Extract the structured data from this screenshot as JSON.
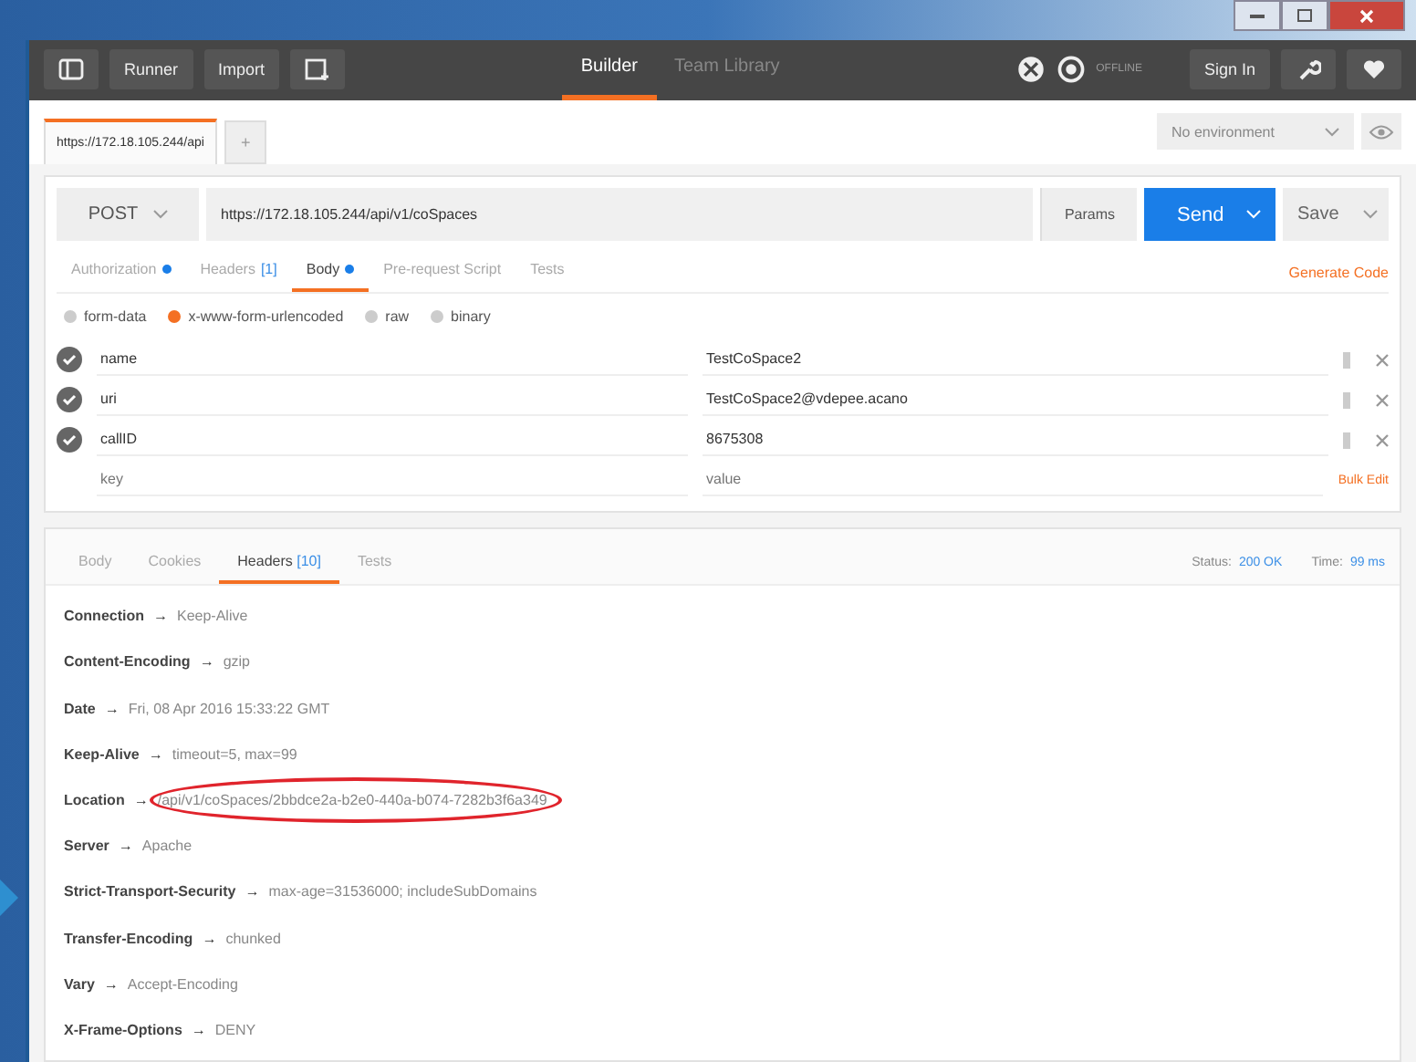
{
  "toolbar": {
    "buttons": [
      "Runner",
      "Import"
    ],
    "tabs": [
      {
        "label": "Builder",
        "selected": true
      },
      {
        "label": "Team Library",
        "selected": false
      }
    ],
    "status": "OFFLINE",
    "sign_in": "Sign In"
  },
  "request_tabs": [
    {
      "label": "https://172.18.105.244/api",
      "selected": true
    }
  ],
  "new_tab": "+",
  "environment": {
    "value": "No environment"
  },
  "request": {
    "method": "POST",
    "url": "https://172.18.105.244/api/v1/coSpaces",
    "params": "Params",
    "send": "Send",
    "save": "Save"
  },
  "request_sections": [
    {
      "label": "Authorization",
      "has_content": true,
      "selected": false
    },
    {
      "label": "Headers",
      "count": "[1]",
      "has_content": false,
      "selected": false
    },
    {
      "label": "Body",
      "has_content": true,
      "selected": true
    },
    {
      "label": "Pre-request Script",
      "has_content": false,
      "selected": false
    },
    {
      "label": "Tests",
      "has_content": false,
      "selected": false
    }
  ],
  "generate_code": "Generate Code",
  "body_modes": [
    {
      "label": "form-data",
      "selected": false
    },
    {
      "label": "x-www-form-urlencoded",
      "selected": true
    },
    {
      "label": "raw",
      "selected": false
    },
    {
      "label": "binary",
      "selected": false
    }
  ],
  "params": [
    {
      "key": "name",
      "value": "TestCoSpace2",
      "checked": true
    },
    {
      "key": "uri",
      "value": "TestCoSpace2@vdepee.acano",
      "checked": true
    },
    {
      "key": "callID",
      "value": "8675308",
      "checked": true
    }
  ],
  "new_param": {
    "key_placeholder": "key",
    "value_placeholder": "value"
  },
  "bulk_edit": "Bulk Edit",
  "response": {
    "tabs": [
      {
        "label": "Body",
        "selected": false
      },
      {
        "label": "Cookies",
        "selected": false
      },
      {
        "label": "Headers",
        "count": "[10]",
        "selected": true
      },
      {
        "label": "Tests",
        "selected": false
      }
    ],
    "status_label": "Status:",
    "status": "200 OK",
    "time_label": "Time:",
    "time": "99 ms",
    "headers": [
      {
        "name": "Connection",
        "arrow": "→",
        "value": "Keep-Alive",
        "highlighted": false
      },
      {
        "name": "Content-Encoding",
        "arrow": "→",
        "value": "gzip",
        "highlighted": false
      },
      {
        "name": "Date",
        "arrow": "→",
        "value": "Fri, 08 Apr 2016 15:33:22 GMT",
        "highlighted": false
      },
      {
        "name": "Keep-Alive",
        "arrow": "→",
        "value": "timeout=5, max=99",
        "highlighted": false
      },
      {
        "name": "Location",
        "arrow": "→",
        "value": "/api/v1/coSpaces/2bbdce2a-b2e0-440a-b074-7282b3f6a349",
        "highlighted": true
      },
      {
        "name": "Server",
        "arrow": "→",
        "value": "Apache",
        "highlighted": false
      },
      {
        "name": "Strict-Transport-Security",
        "arrow": "→",
        "value": "max-age=31536000; includeSubDomains",
        "highlighted": false
      },
      {
        "name": "Transfer-Encoding",
        "arrow": "→",
        "value": "chunked",
        "highlighted": false
      },
      {
        "name": "Vary",
        "arrow": "→",
        "value": "Accept-Encoding",
        "highlighted": false
      },
      {
        "name": "X-Frame-Options",
        "arrow": "→",
        "value": "DENY",
        "highlighted": false
      }
    ]
  }
}
